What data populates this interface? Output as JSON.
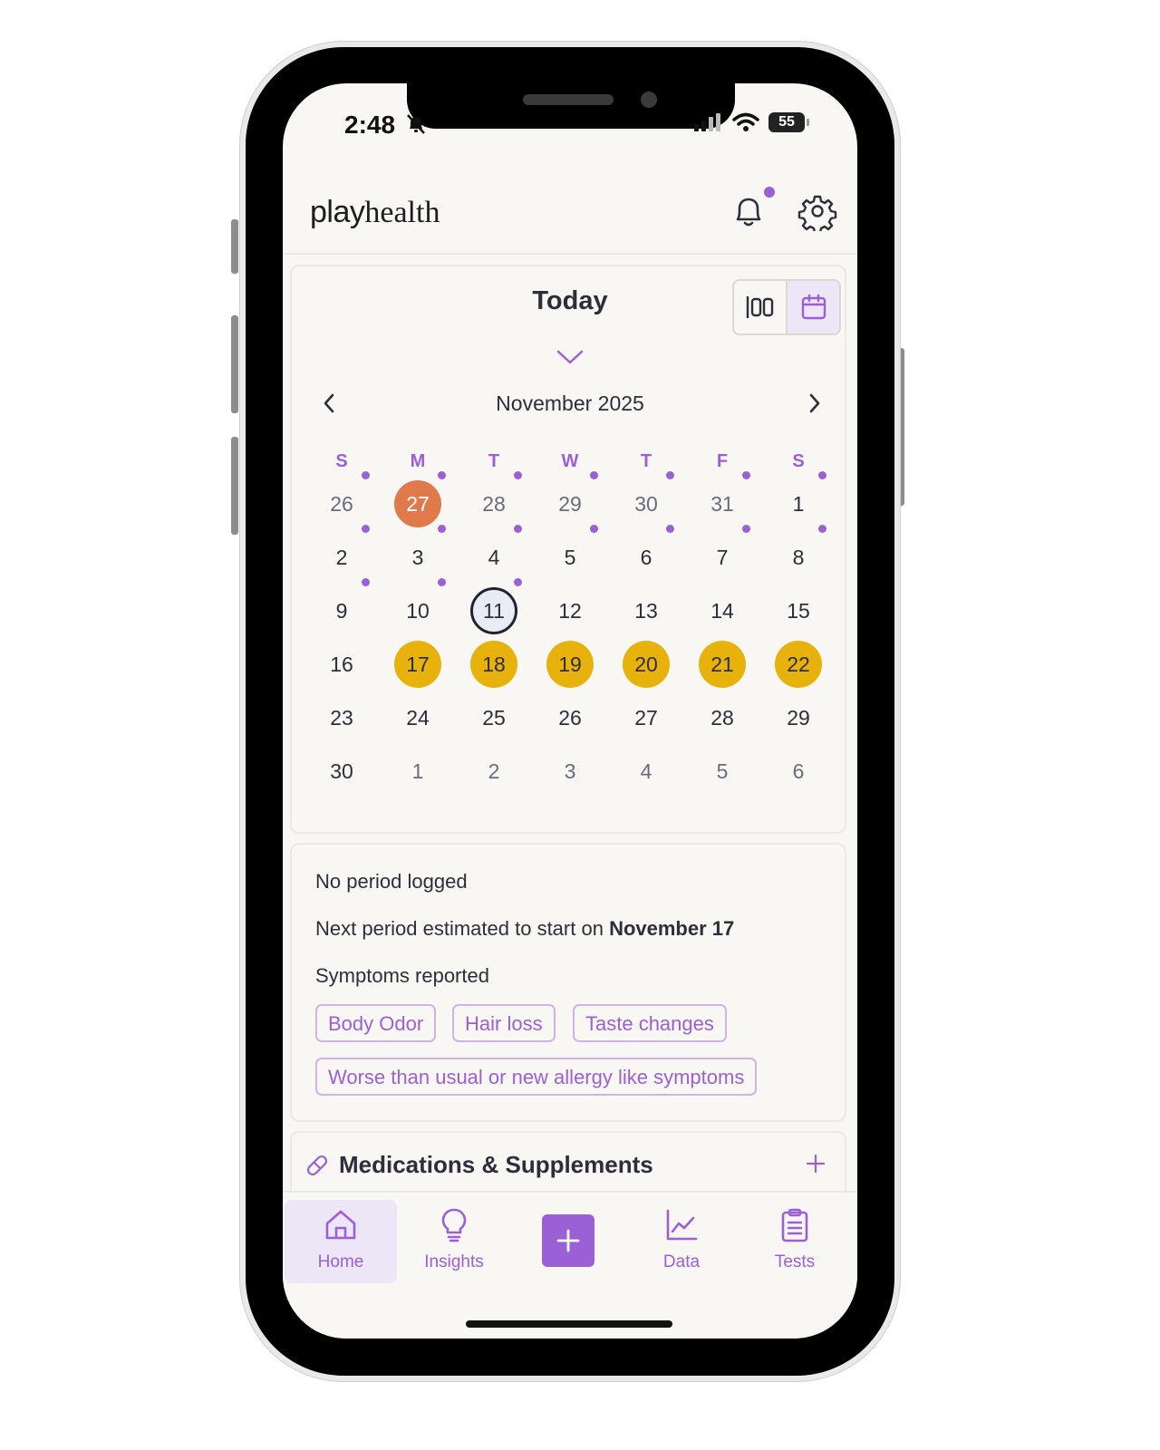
{
  "status_bar": {
    "time": "2:48",
    "battery": "55"
  },
  "header": {
    "logo_play": "play",
    "logo_health": "health"
  },
  "calendar": {
    "view_label": "Today",
    "month": "November 2025",
    "weekdays": [
      "S",
      "M",
      "T",
      "W",
      "T",
      "F",
      "S"
    ],
    "weeks": [
      [
        "26",
        "27",
        "28",
        "29",
        "30",
        "31",
        "1"
      ],
      [
        "2",
        "3",
        "4",
        "5",
        "6",
        "7",
        "8"
      ],
      [
        "9",
        "10",
        "11",
        "12",
        "13",
        "14",
        "15"
      ],
      [
        "16",
        "17",
        "18",
        "19",
        "20",
        "21",
        "22"
      ],
      [
        "23",
        "24",
        "25",
        "26",
        "27",
        "28",
        "29"
      ],
      [
        "30",
        "1",
        "2",
        "3",
        "4",
        "5",
        "6"
      ]
    ],
    "logged_period_day": "27",
    "current_day": "11",
    "predicted_period_days": [
      "17",
      "18",
      "19",
      "20",
      "21",
      "22"
    ]
  },
  "summary": {
    "period_status": "No period logged",
    "next_period_prefix": "Next period estimated to start on ",
    "next_period_date": "November 17",
    "symptoms_heading": "Symptoms reported",
    "symptoms": [
      "Body Odor",
      "Hair loss",
      "Taste changes",
      "Worse than usual or new allergy like symptoms"
    ]
  },
  "medications": {
    "title": "Medications & Supplements"
  },
  "tabbar": {
    "home": "Home",
    "insights": "Insights",
    "data": "Data",
    "tests": "Tests"
  },
  "colors": {
    "accent": "#9b5fd6",
    "period": "#e07a4d",
    "predicted": "#e8b20c",
    "background": "#f8f7f3"
  }
}
